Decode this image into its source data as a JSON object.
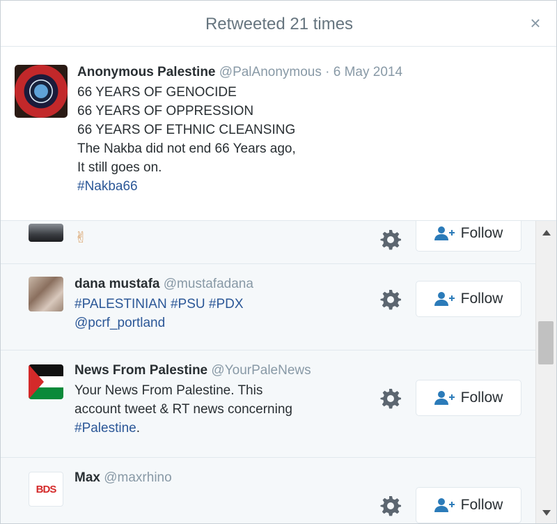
{
  "dialog": {
    "title": "Retweeted 21 times",
    "close_glyph": "×"
  },
  "tweet": {
    "name": "Anonymous Palestine",
    "handle": "@PalAnonymous",
    "date": "· 6 May 2014",
    "lines": [
      "66 YEARS OF GENOCIDE",
      "66 YEARS OF OPPRESSION",
      "66 YEARS OF ETHNIC CLEANSING",
      "The Nakba did not end 66 Years ago,",
      "It still goes on."
    ],
    "hashtag": "#Nakba66"
  },
  "users": [
    {
      "name": "",
      "handle": "",
      "bio_text": "✌",
      "follow_label": "Follow"
    },
    {
      "name": "dana mustafa",
      "handle": "@mustafadana",
      "bio_link1": "#PALESTINIAN #PSU #PDX",
      "bio_link2": "@pcrf_portland",
      "follow_label": "Follow"
    },
    {
      "name": "News From Palestine",
      "handle": "@YourPaleNews",
      "bio_line1": "Your News From Palestine. This",
      "bio_line2": "account tweet & RT news concerning",
      "bio_link": "#Palestine",
      "bio_tail": ".",
      "follow_label": "Follow"
    },
    {
      "name": "Max",
      "handle": "@maxrhino",
      "avatar_text": "BDS",
      "follow_label": "Follow"
    }
  ],
  "icons": {
    "gear": "gear-icon",
    "follow": "add-user-icon",
    "close": "close-icon"
  },
  "colors": {
    "link": "#2b5797",
    "text": "#292f33",
    "muted": "#8899a6"
  }
}
